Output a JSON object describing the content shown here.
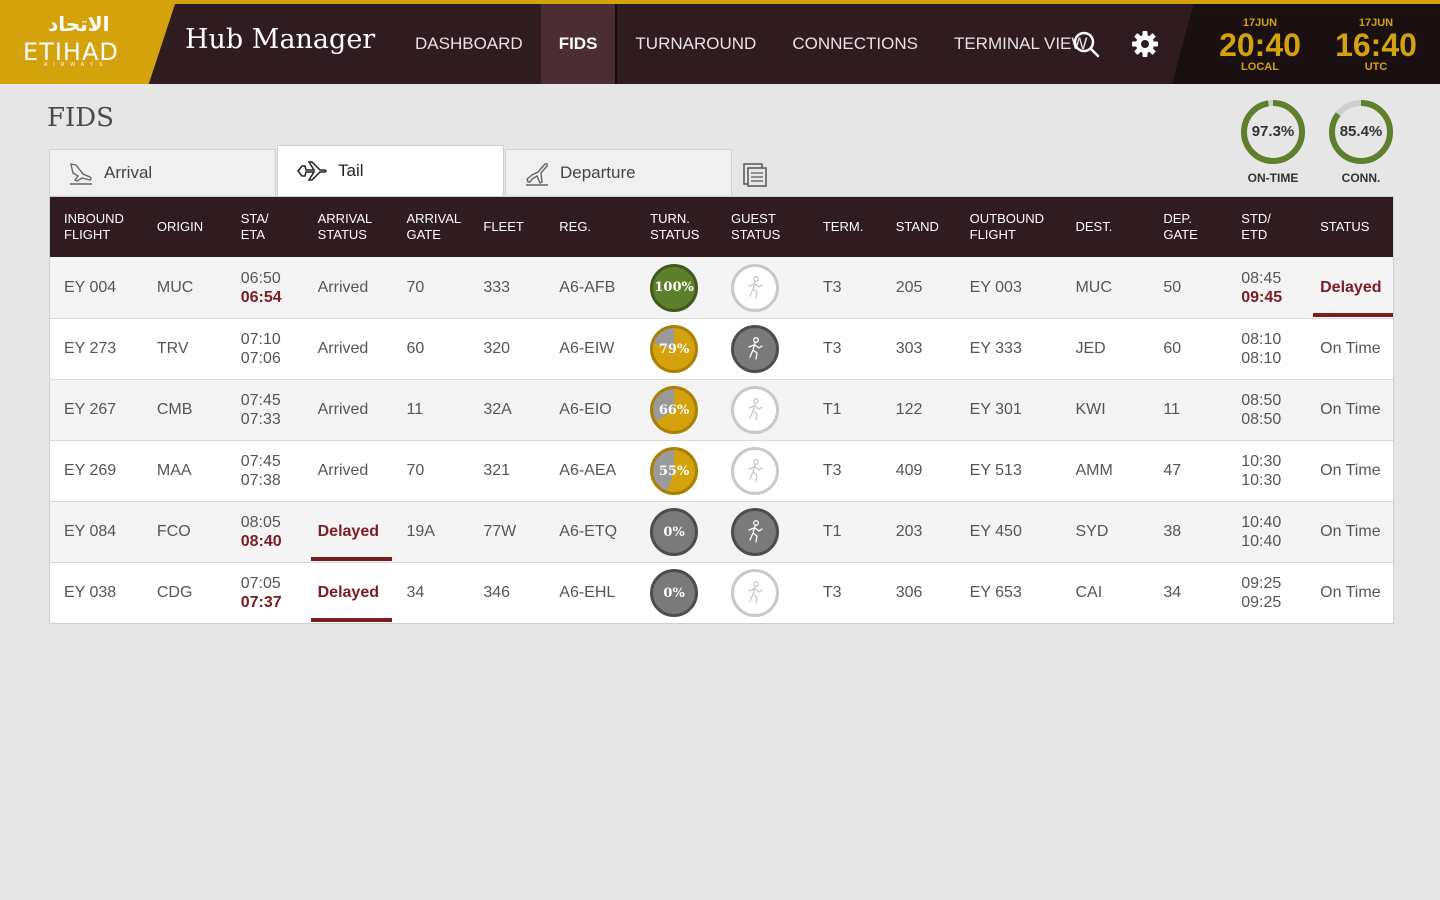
{
  "header": {
    "logo_arabic": "الاتحاد",
    "logo_text": "ETIHAD",
    "logo_sub": "AIRWAYS",
    "app_title": "Hub Manager",
    "nav": [
      {
        "label": "DASHBOARD",
        "active": false
      },
      {
        "label": "FIDS",
        "active": true
      },
      {
        "label": "TURNAROUND",
        "active": false
      },
      {
        "label": "CONNECTIONS",
        "active": false
      },
      {
        "label": "TERMINAL VIEW",
        "active": false
      }
    ],
    "icons": [
      "search-icon",
      "gear-icon"
    ],
    "clock_local": {
      "date": "17JUN",
      "time": "20:40",
      "tz": "LOCAL"
    },
    "clock_utc": {
      "date": "17JUN",
      "time": "16:40",
      "tz": "UTC"
    }
  },
  "page": {
    "title": "FIDS",
    "gauges": [
      {
        "value": "97.3%",
        "label": "ON-TIME",
        "fraction": 0.973
      },
      {
        "value": "85.4%",
        "label": "CONN.",
        "fraction": 0.854
      }
    ],
    "tabs": [
      {
        "label": "Arrival",
        "icon": "arrival-plane-icon",
        "active": false
      },
      {
        "label": "Tail",
        "icon": "tail-plane-icon",
        "active": true
      },
      {
        "label": "Departure",
        "icon": "departure-plane-icon",
        "active": false
      }
    ],
    "export_icon": "export-icon"
  },
  "colors": {
    "brand_gold": "#d4a20c",
    "header_bg": "#2e1c20",
    "delayed_red": "#7a1c22",
    "turn_green": "#5e7f2c",
    "turn_gold": "#d4a20c",
    "turn_grey": "#7a7a7a"
  },
  "table": {
    "columns": [
      [
        "INBOUND",
        "FLIGHT"
      ],
      [
        "ORIGIN",
        ""
      ],
      [
        "STA/",
        "ETA"
      ],
      [
        "ARRIVAL",
        "STATUS"
      ],
      [
        "ARRIVAL",
        "GATE"
      ],
      [
        "FLEET",
        ""
      ],
      [
        "REG.",
        ""
      ],
      [
        "TURN.",
        "STATUS"
      ],
      [
        "GUEST",
        "STATUS"
      ],
      [
        "TERM.",
        ""
      ],
      [
        "STAND",
        ""
      ],
      [
        "OUTBOUND",
        "FLIGHT"
      ],
      [
        "DEST.",
        ""
      ],
      [
        "DEP.",
        "GATE"
      ],
      [
        "STD/",
        "ETD"
      ],
      [
        "STATUS",
        ""
      ]
    ],
    "rows": [
      {
        "inbound": "EY 004",
        "origin": "MUC",
        "sta": "06:50",
        "eta": "06:54",
        "eta_late": true,
        "arr_status": "Arrived",
        "arr_delayed": false,
        "arr_gate": "70",
        "fleet": "333",
        "reg": "A6-AFB",
        "turn": "100%",
        "turn_pct": 1.0,
        "guest_active": false,
        "term": "T3",
        "stand": "205",
        "outbound": "EY 003",
        "dest": "MUC",
        "dep_gate": "50",
        "std": "08:45",
        "etd": "09:45",
        "etd_late": true,
        "status": "Delayed",
        "status_delayed": true
      },
      {
        "inbound": "EY 273",
        "origin": "TRV",
        "sta": "07:10",
        "eta": "07:06",
        "eta_late": false,
        "arr_status": "Arrived",
        "arr_delayed": false,
        "arr_gate": "60",
        "fleet": "320",
        "reg": "A6-EIW",
        "turn": "79%",
        "turn_pct": 0.79,
        "guest_active": true,
        "term": "T3",
        "stand": "303",
        "outbound": "EY 333",
        "dest": "JED",
        "dep_gate": "60",
        "std": "08:10",
        "etd": "08:10",
        "etd_late": false,
        "status": "On Time",
        "status_delayed": false
      },
      {
        "inbound": "EY 267",
        "origin": "CMB",
        "sta": "07:45",
        "eta": "07:33",
        "eta_late": false,
        "arr_status": "Arrived",
        "arr_delayed": false,
        "arr_gate": "11",
        "fleet": "32A",
        "reg": "A6-EIO",
        "turn": "66%",
        "turn_pct": 0.66,
        "guest_active": false,
        "term": "T1",
        "stand": "122",
        "outbound": "EY 301",
        "dest": "KWI",
        "dep_gate": "11",
        "std": "08:50",
        "etd": "08:50",
        "etd_late": false,
        "status": "On Time",
        "status_delayed": false
      },
      {
        "inbound": "EY 269",
        "origin": "MAA",
        "sta": "07:45",
        "eta": "07:38",
        "eta_late": false,
        "arr_status": "Arrived",
        "arr_delayed": false,
        "arr_gate": "70",
        "fleet": "321",
        "reg": "A6-AEA",
        "turn": "55%",
        "turn_pct": 0.55,
        "guest_active": false,
        "term": "T3",
        "stand": "409",
        "outbound": "EY 513",
        "dest": "AMM",
        "dep_gate": "47",
        "std": "10:30",
        "etd": "10:30",
        "etd_late": false,
        "status": "On Time",
        "status_delayed": false
      },
      {
        "inbound": "EY 084",
        "origin": "FCO",
        "sta": "08:05",
        "eta": "08:40",
        "eta_late": true,
        "arr_status": "Delayed",
        "arr_delayed": true,
        "arr_gate": "19A",
        "fleet": "77W",
        "reg": "A6-ETQ",
        "turn": "0%",
        "turn_pct": 0.0,
        "guest_active": true,
        "term": "T1",
        "stand": "203",
        "outbound": "EY 450",
        "dest": "SYD",
        "dep_gate": "38",
        "std": "10:40",
        "etd": "10:40",
        "etd_late": false,
        "status": "On Time",
        "status_delayed": false
      },
      {
        "inbound": "EY 038",
        "origin": "CDG",
        "sta": "07:05",
        "eta": "07:37",
        "eta_late": true,
        "arr_status": "Delayed",
        "arr_delayed": true,
        "arr_gate": "34",
        "fleet": "346",
        "reg": "A6-EHL",
        "turn": "0%",
        "turn_pct": 0.0,
        "guest_active": false,
        "term": "T3",
        "stand": "306",
        "outbound": "EY 653",
        "dest": "CAI",
        "dep_gate": "34",
        "std": "09:25",
        "etd": "09:25",
        "etd_late": false,
        "status": "On Time",
        "status_delayed": false
      }
    ]
  }
}
